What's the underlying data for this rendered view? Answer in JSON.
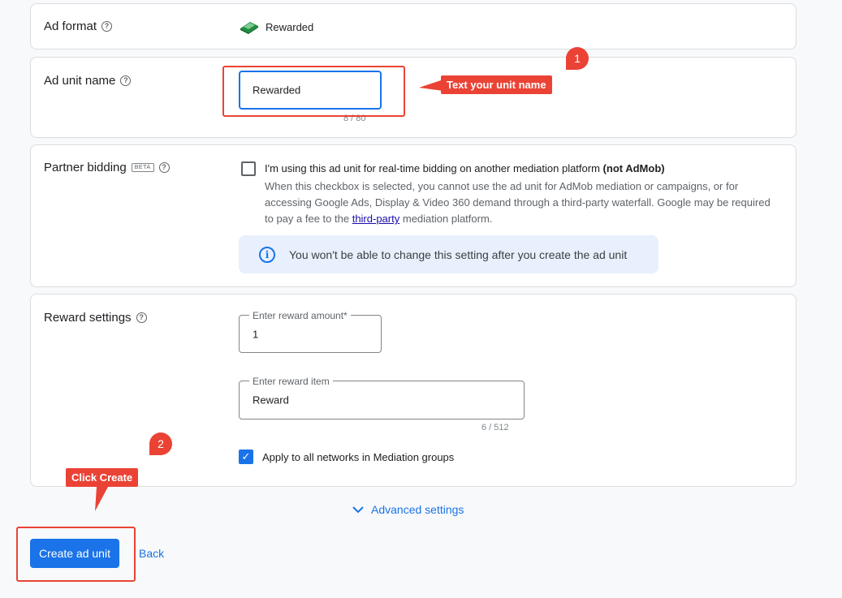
{
  "ad_format": {
    "label": "Ad format",
    "help_icon": "?",
    "value": "Rewarded",
    "icon": "rewarded-format-icon"
  },
  "ad_unit_name": {
    "label": "Ad unit name",
    "help_icon": "?",
    "value": "Rewarded",
    "counter": "8 / 80"
  },
  "partner_bidding": {
    "label": "Partner bidding",
    "badge": "BETA",
    "help_icon": "?",
    "checkbox_label": "I'm using this ad unit for real-time bidding on another mediation platform",
    "checkbox_label_bold": "(not AdMob)",
    "description_1": "When this checkbox is selected, you cannot use the ad unit for AdMob mediation or campaigns, or for accessing Google Ads, Display & Video 360 demand through a third-party waterfall. Google may be required to pay a fee to the",
    "description_link": "third-party",
    "description_2": "mediation platform.",
    "info_text": "You won't be able to change this setting after you create the ad unit",
    "info_icon": "i"
  },
  "reward_settings": {
    "label": "Reward settings",
    "help_icon": "?",
    "amount_label": "Enter reward amount*",
    "amount_value": "1",
    "item_label": "Enter reward item",
    "item_value": "Reward",
    "item_counter": "6 / 512",
    "apply_label": "Apply to all networks in Mediation groups",
    "apply_check": "✓"
  },
  "advanced": {
    "label": "Advanced settings"
  },
  "actions": {
    "create_label": "Create ad unit",
    "back_label": "Back"
  },
  "annotations": {
    "num_1": "1",
    "tag_1": "Text your unit name",
    "num_2": "2",
    "tag_2": "Click Create"
  },
  "colors": {
    "accent": "#1a73e8",
    "annotation": "#ea4335",
    "info_bg": "#e8f0fe"
  }
}
